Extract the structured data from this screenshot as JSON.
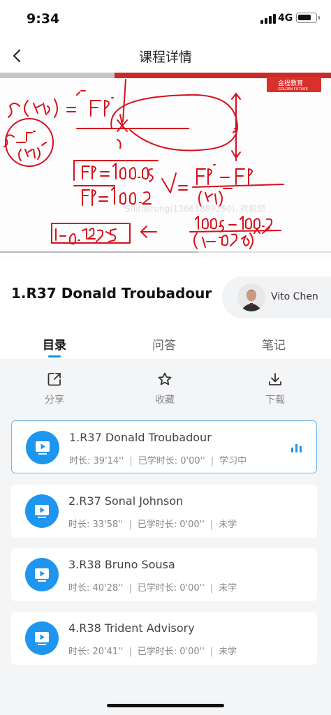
{
  "status_bar": {
    "time": "9:34",
    "network": "4G",
    "battery_level": 0.8
  },
  "nav": {
    "title": "课程详情"
  },
  "video": {
    "logo_text": "金程教育",
    "logo_sub": "GOLDEN FUTURE",
    "watermark": "Shihairong(13661889290), 欢迎您",
    "progress": 0.6
  },
  "course": {
    "title": "1.R37 Donald Troubadour"
  },
  "teacher": {
    "name": "Vito Chen"
  },
  "tabs": [
    {
      "label": "目录",
      "active": true
    },
    {
      "label": "问答",
      "active": false
    },
    {
      "label": "笔记",
      "active": false
    }
  ],
  "actions": [
    {
      "label": "分享",
      "icon": "share-icon"
    },
    {
      "label": "收藏",
      "icon": "star-icon"
    },
    {
      "label": "下载",
      "icon": "download-icon"
    }
  ],
  "lessons": [
    {
      "title": "1.R37 Donald Troubadour",
      "duration_label": "时长: 39'14''",
      "studied_label": "已学时长: 0'00''",
      "status": "学习中",
      "active": true
    },
    {
      "title": "2.R37 Sonal Johnson",
      "duration_label": "时长: 33'58''",
      "studied_label": "已学时长: 0'00''",
      "status": "未学",
      "active": false
    },
    {
      "title": "3.R38 Bruno Sousa",
      "duration_label": "时长: 40'28''",
      "studied_label": "已学时长: 0'00''",
      "status": "未学",
      "active": false
    },
    {
      "title": "4.R38 Trident Advisory",
      "duration_label": "时长: 20'41''",
      "studied_label": "已学时长: 0'00''",
      "status": "未学",
      "active": false
    }
  ],
  "separator": "|",
  "colors": {
    "accent": "#1e96ef",
    "handwriting": "#d8101c",
    "logo": "#d9302c"
  }
}
